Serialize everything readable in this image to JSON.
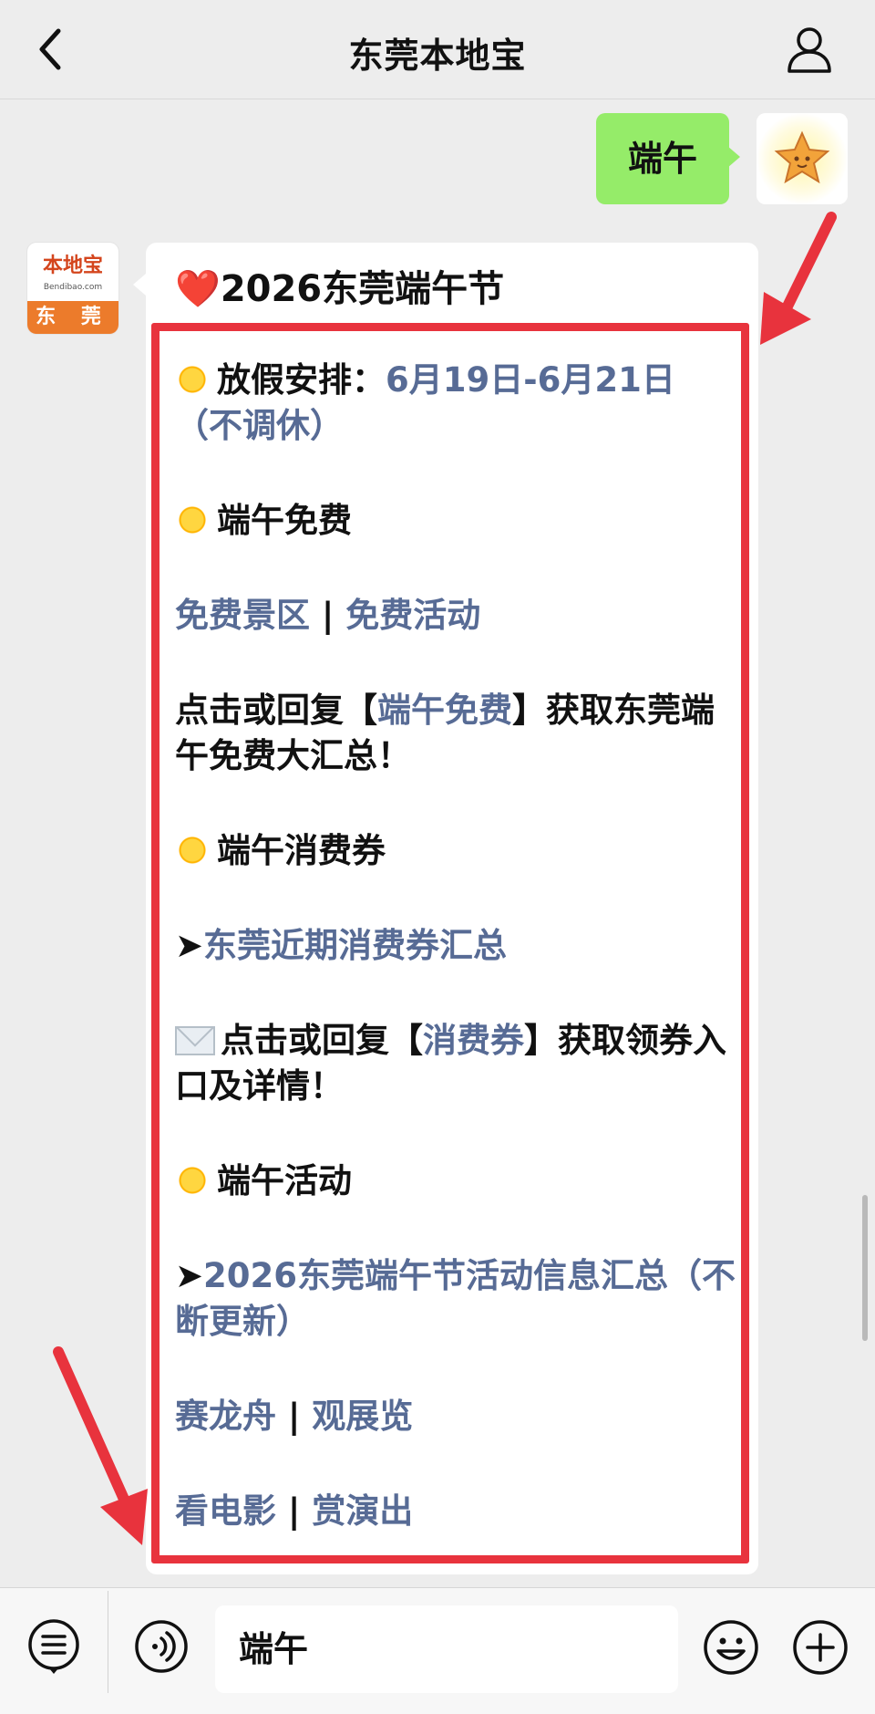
{
  "navbar": {
    "title": "东莞本地宝"
  },
  "my_message": {
    "text": "端午"
  },
  "bot_avatar": {
    "brand": "本地宝",
    "site": "Bendibao.com",
    "city": "东 莞"
  },
  "bot_message": {
    "title_emoji": "❤️",
    "title": "2026东莞端午节",
    "holiday_label": "放假安排：",
    "holiday_dates": "6月19日-6月21日（不调休）",
    "free_heading": "端午免费",
    "free_scenic_link": "免费景区",
    "free_activity_link": "免费活动",
    "separator": " | ",
    "free_reply_prefix": "点击或回复【",
    "free_reply_keyword": "端午免费",
    "free_reply_suffix": "】获取东莞端午免费大汇总！",
    "coupon_heading": "端午消费券",
    "arrow_glyph": "➤",
    "coupon_link": "东莞近期消费券汇总",
    "coupon_reply_prefix": "点击或回复【",
    "coupon_reply_keyword": "消费券",
    "coupon_reply_suffix": "】获取领券入口及详情！",
    "activity_heading": "端午活动",
    "activity_link": "2026东莞端午节活动信息汇总（不断更新）",
    "dragon_boat_link": "赛龙舟",
    "exhibition_link": "观展览",
    "movie_link": "看电影",
    "show_link": "赏演出"
  },
  "input_bar": {
    "value": "端午"
  },
  "colors": {
    "link": "#576b95",
    "highlight": "#e8333d",
    "my_bubble": "#95ec69",
    "background": "#ededed"
  },
  "icons": [
    "back-chevron-icon",
    "profile-icon",
    "sun-icon",
    "envelope-icon",
    "menu-icon",
    "voice-icon",
    "emoji-icon",
    "plus-icon"
  ]
}
